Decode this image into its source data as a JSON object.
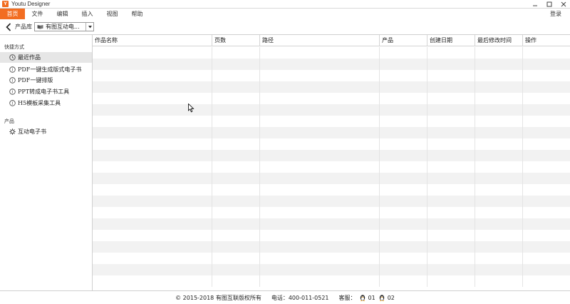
{
  "window": {
    "title": "Youtu Designer",
    "logo_text": "Y"
  },
  "menu": {
    "items": [
      "首页",
      "文件",
      "编辑",
      "插入",
      "视图",
      "帮助"
    ],
    "login": "登录"
  },
  "toolbar": {
    "label": "产品库",
    "selected_library": "有图互动电..."
  },
  "sidebar": {
    "shortcuts_title": "快捷方式",
    "shortcuts": [
      {
        "label": "最近作品",
        "icon": "clock-icon"
      },
      {
        "label": "PDF一键生成版式电子书",
        "icon": "info-icon"
      },
      {
        "label": "PDF一键排版",
        "icon": "info-icon"
      },
      {
        "label": "PPT转成电子书工具",
        "icon": "info-icon"
      },
      {
        "label": "H5模板采集工具",
        "icon": "info-icon"
      }
    ],
    "products_title": "产品",
    "products": [
      {
        "label": "互动电子书",
        "icon": "gear-icon"
      }
    ]
  },
  "table": {
    "columns": [
      "作品名称",
      "页数",
      "路径",
      "产品",
      "创建日期",
      "最后修改时间",
      "操作"
    ],
    "rows": []
  },
  "footer": {
    "copyright": "© 2015-2018 有图互联版权所有",
    "phone": "电话：400-011-0521",
    "service_label": "客服：",
    "service_1": "01",
    "service_2": "02"
  }
}
